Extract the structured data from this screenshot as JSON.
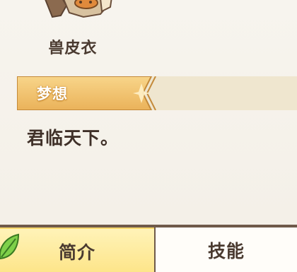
{
  "item": {
    "name": "兽皮衣",
    "icon": "fur-coat-icon"
  },
  "dream": {
    "label": "梦想",
    "text": "君临天下。"
  },
  "tabs": {
    "intro_label": "简介",
    "skill_label": "技能",
    "active": "简介"
  },
  "colors": {
    "banner_gold": "#f0c46a",
    "tab_active": "#fde58a",
    "text_dark": "#4a3a30"
  }
}
